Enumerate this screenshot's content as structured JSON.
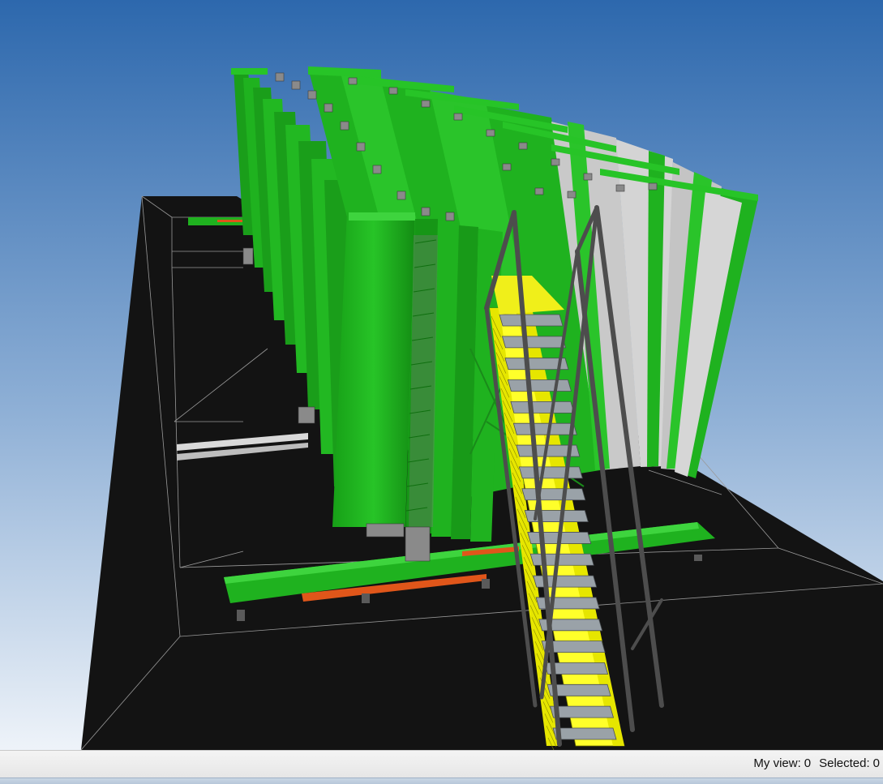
{
  "status_bar": {
    "my_view_label": "My view:",
    "my_view_value": "0",
    "selected_label": "Selected:",
    "selected_value": "0"
  },
  "colors": {
    "sky_top": "#2d68ad",
    "sky_bottom": "#eef3f9",
    "ground": "#131313",
    "frame_green": "#1fb21f",
    "frame_green_light": "#3ed43e",
    "panel_grey": "#c9c9c9",
    "rail_orange": "#e0561a",
    "stair_yellow": "#ffff2a",
    "steel_grey": "#5a5a5a"
  }
}
